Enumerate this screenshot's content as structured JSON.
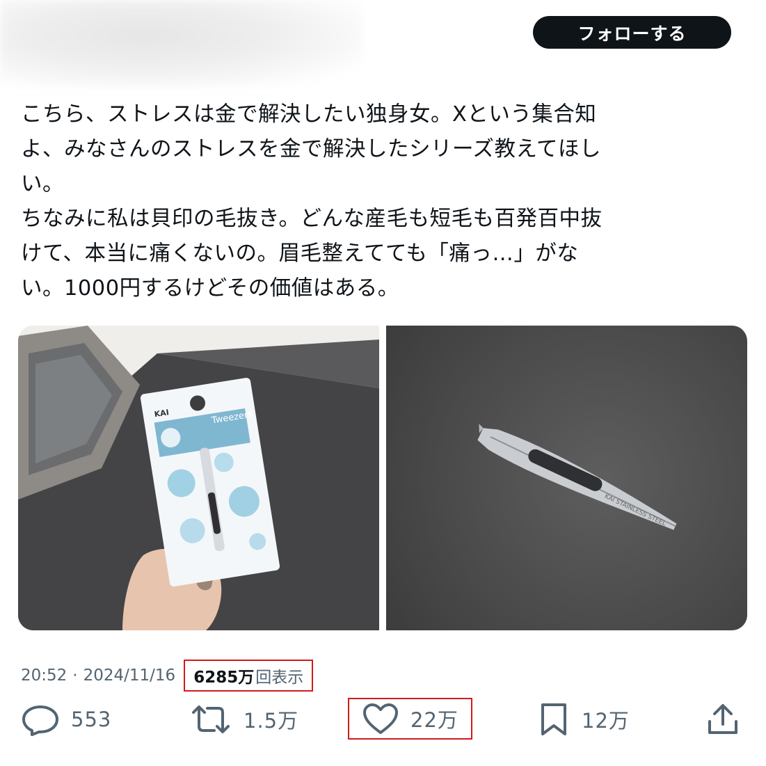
{
  "header": {
    "follow_label": "フォローする"
  },
  "tweet": {
    "lines": [
      "こちら、ストレスは金で解決したい独身女。Xという集合知",
      "よ、みなさんのストレスを金で解決したシリーズ教えてほし",
      "い。",
      "ちなみに私は貝印の毛抜き。どんな産毛も短毛も百発百中抜",
      "けて、本当に痛くないの。眉毛整えてても「痛っ…」がな",
      "い。1000円するけどその価値はある。"
    ]
  },
  "media": {
    "package_brand": "KAI",
    "package_title": "Tweezers",
    "tweezer_engraving": "KAI STAINLESS STEEL"
  },
  "meta": {
    "time": "20:52",
    "separator": "·",
    "date": "2024/11/16",
    "views_count": "6285万",
    "views_label": "回表示"
  },
  "actions": {
    "replies": "553",
    "reposts": "1.5万",
    "likes": "22万",
    "bookmarks": "12万"
  },
  "colors": {
    "accent_highlight": "#d11a1a",
    "text_primary": "#0f1419",
    "text_secondary": "#536471"
  }
}
